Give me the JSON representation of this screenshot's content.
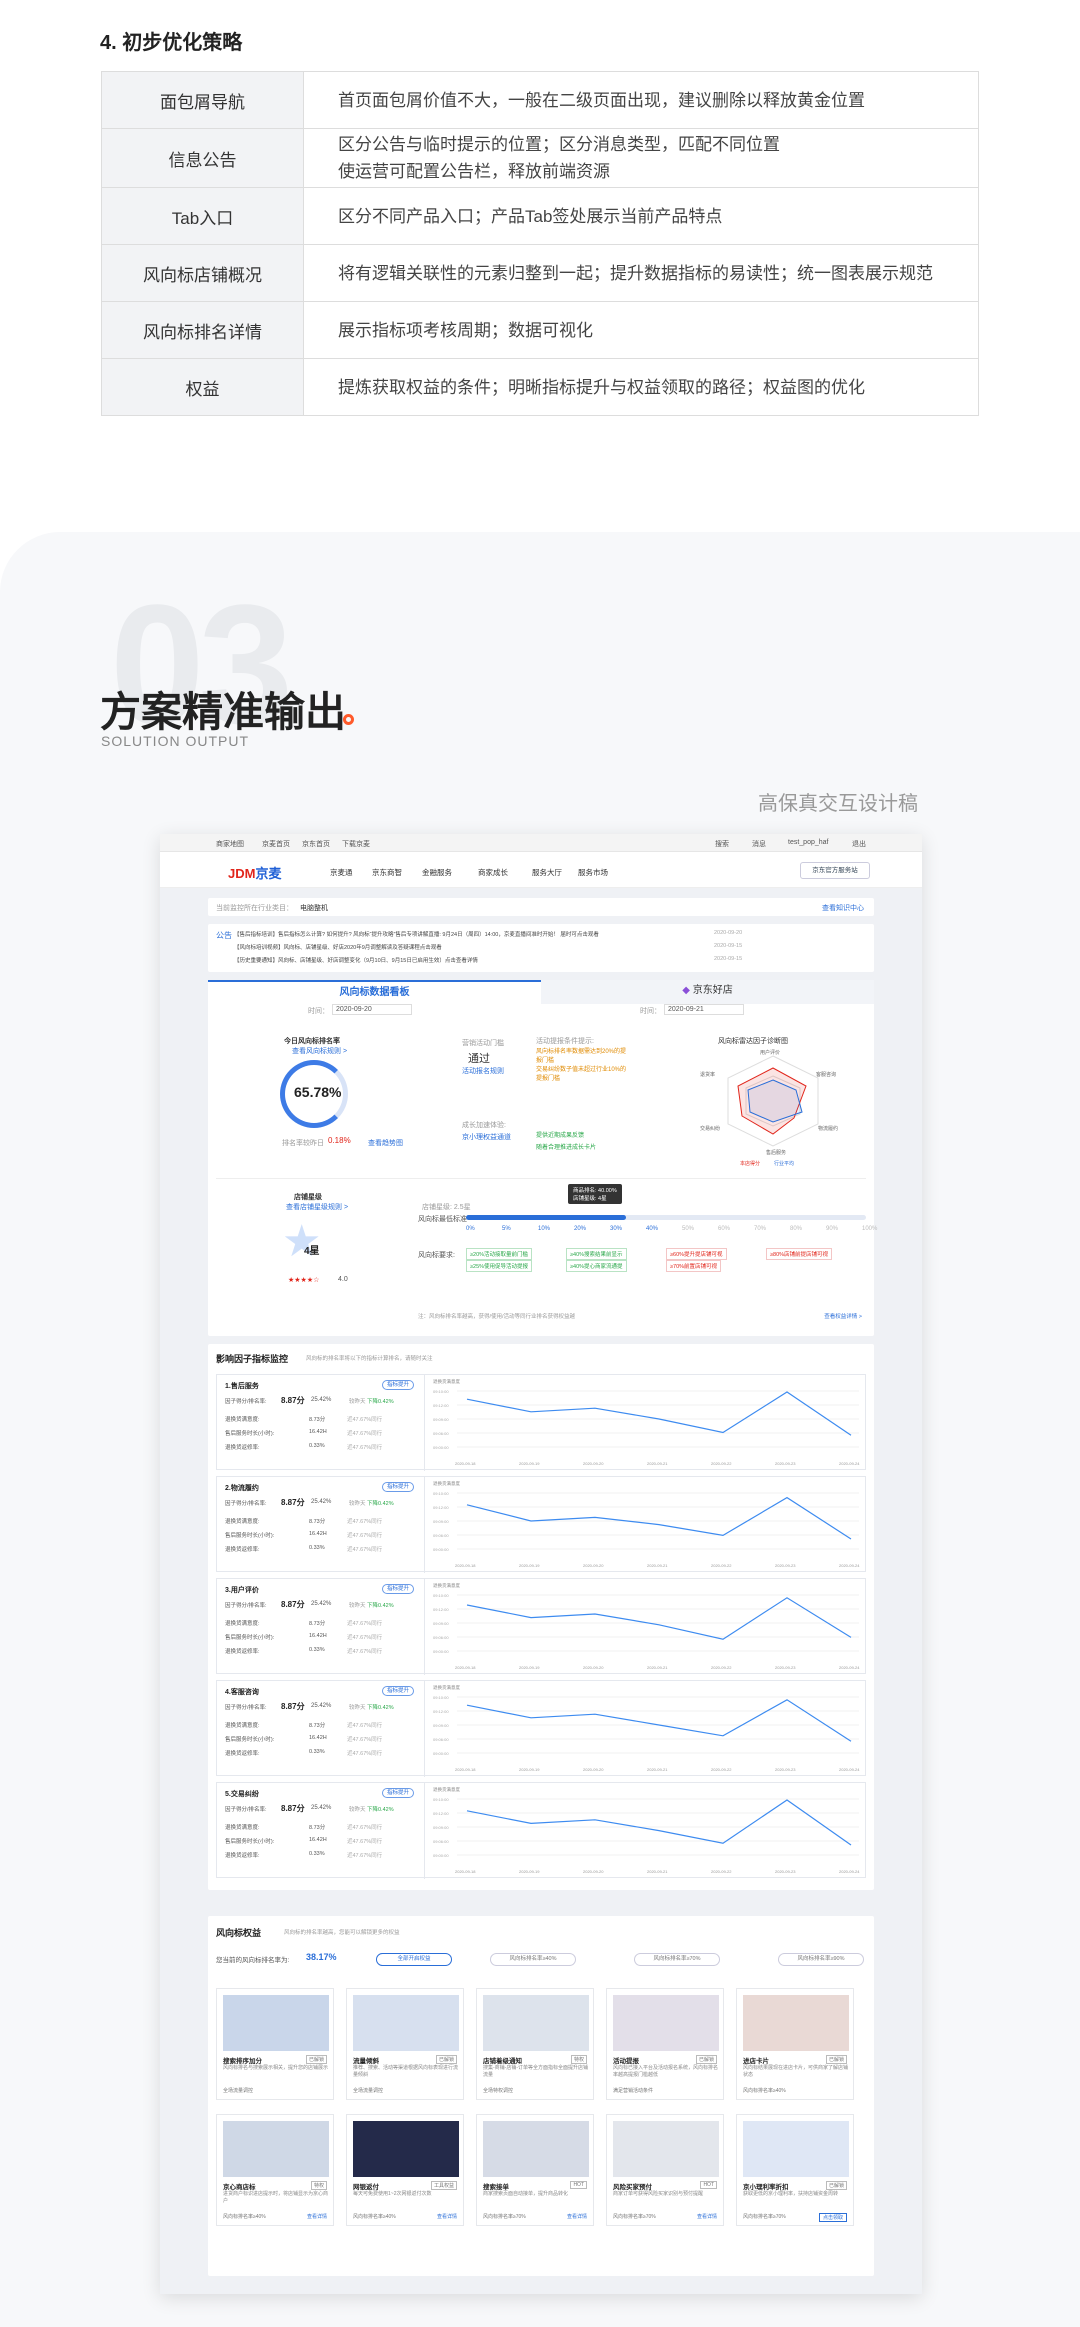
{
  "section4": {
    "title": "4. 初步优化策略",
    "rows": [
      {
        "k": "面包屑导航",
        "v": "首页面包屑价值不大，一般在二级页面出现，建议删除以释放黄金位置"
      },
      {
        "k": "信息公告",
        "v": "区分公告与临时提示的位置；区分消息类型，匹配不同位置\n使运营可配置公告栏，释放前端资源"
      },
      {
        "k": "Tab入口",
        "v": "区分不同产品入口；产品Tab签处展示当前产品特点"
      },
      {
        "k": "风向标店铺概况",
        "v": "将有逻辑关联性的元素归整到一起；提升数据指标的易读性；统一图表展示规范"
      },
      {
        "k": "风向标排名详情",
        "v": "展示指标项考核周期；数据可视化"
      },
      {
        "k": "权益",
        "v": "提炼获取权益的条件；明晰指标提升与权益领取的路径；权益图的优化"
      }
    ]
  },
  "section3": {
    "number": "03",
    "title": "方案精准输出",
    "subtitle": "SOLUTION OUTPUT",
    "caption": "高保真交互设计稿"
  },
  "mock": {
    "topbar": [
      "商家地图",
      "京麦首页",
      "京东首页",
      "下载京麦"
    ],
    "topbar_right": [
      "搜索",
      "消息",
      "test_pop_haf",
      "退出"
    ],
    "logo_main": "JDM",
    "logo_sub": "京麦",
    "nav": [
      "京麦通",
      "京东商智",
      "金融服务",
      "商家成长",
      "服务大厅",
      "服务市场"
    ],
    "nav_btn": "京东官方服务站",
    "crumb_label": "当前监控所在行业类目：",
    "crumb_value": "电脑整机",
    "crumb_link": "查看知识中心",
    "notice_label": "公告",
    "notices": [
      "【售后指标培训】售后指标怎么计算? 如何提升? 风向标“提升攻略”售后专项讲解直播: 9月24日（周四）14:00，京麦直播间准时开始！ 届时可点击观看",
      "【风向标培训视频】风向标、店铺星级、好店2020年9月调整解读及答疑课程点击观看",
      "【历史重要通知】风向标、店铺星级、好店调整变化（9月10日、9月15日已启用生效）点击查看详情"
    ],
    "notice_dates": [
      "2020-09-20",
      "2020-09-15",
      "2020-09-15"
    ],
    "tab_active": "风向标数据看板",
    "tab_other": "京东好店",
    "date_label": "时间：",
    "date_a": "2020-09-20",
    "date_b": "2020-09-21",
    "score_title": "今日风向标排名率",
    "score_link": "查看风向标规则 >",
    "score_value": "65.78%",
    "score_trend_label": "排名率较昨日",
    "score_trend": "0.18%",
    "score_trend_link": "查看趋势图",
    "threshold_title": "营销活动门槛",
    "threshold_value": "通过",
    "threshold_link": "活动报名规则",
    "threshold_tips_title": "活动提报条件提示:",
    "threshold_tips": [
      "风向标排名率数据需达到20%的提报门槛",
      "交易纠纷数子值未超过行业10%的提报门槛"
    ],
    "growth_title": "成长加速体验:",
    "growth_value": "京小理权益通道",
    "growth_tips": [
      "提供近期成果反馈",
      "随着合理推进成长卡片"
    ],
    "radar_title": "风向标雷达因子诊断图",
    "radar_labels": [
      "用户评价",
      "客服咨询",
      "物流履约",
      "售后服务",
      "交易纠纷",
      "退货率"
    ],
    "radar_legend": [
      "本店得分",
      "行业平均"
    ],
    "star_title": "店铺星级",
    "star_link": "查看店铺星级规则 >",
    "star_value": "4星",
    "star_score": "4.0",
    "tooltip": [
      "商品排名: 40.00%",
      "店铺星级: 4星"
    ],
    "progress_label_top": "店铺星级: 2.5星",
    "progress_label_row": "风向标最低标准",
    "progress_ticks": [
      "0%",
      "5%",
      "10%",
      "20%",
      "30%",
      "40%",
      "50%",
      "60%",
      "70%",
      "80%",
      "90%",
      "100%"
    ],
    "req_label": "风向标要求:",
    "reqs": [
      "≥20%活动接取量前门槛",
      "≥40%搜索结果前显示",
      "≥60%提升提店铺可视",
      "≥80%店铺前提店铺可视",
      "≥25%使用促导活动提报",
      "≥40%提心商家流通提",
      "≥70%前置店铺可视"
    ],
    "req_footer": "注：风向标排名率越高，获得/使用/活动等同行业排名获得权益越",
    "req_footer_link": "查看权益详情 >",
    "factor_title": "影响因子指标监控",
    "factor_sub": "风向标的排名率将以下的指标计算排名，请随时关注",
    "factor_rows": [
      {
        "name": "1.售后服务"
      },
      {
        "name": "2.物流履约"
      },
      {
        "name": "3.用户评价"
      },
      {
        "name": "4.客服咨询"
      },
      {
        "name": "5.交易纠纷"
      }
    ],
    "factor_badge": "指标提升",
    "factor_score_label": "因子得分/排名率:",
    "factor_score": "8.87分",
    "factor_rank": "25.42%",
    "factor_change_label": "较昨天",
    "factor_change": "下降0.42%",
    "factor_metrics": [
      {
        "label": "退换货满意度:",
        "value": "8.73分",
        "cmp": "近47.67%同行"
      },
      {
        "label": "售后服务时长(小时):",
        "value": "16.42H",
        "cmp": "近47.67%同行"
      },
      {
        "label": "退换货返修率:",
        "value": "0.33%",
        "cmp": "近47.67%同行"
      }
    ],
    "chart_dates": [
      "2020-09-18",
      "2020-09-19",
      "2020-09-20",
      "2020-09-21",
      "2020-09-22",
      "2020-09-23",
      "2020-09-24"
    ],
    "chart_ylabels": [
      "09:10:00",
      "09:12:00",
      "09:09:00",
      "09:06:00",
      "09:00:00"
    ],
    "chart_legend": "退换货满意度",
    "rights_title": "风向标权益",
    "rights_sub": "风向标的排名率越高，您能可以解锁更多的权益",
    "rights_rate_label": "您当前的风向标排名率为:",
    "rights_rate": "38.17%",
    "rights_pills": [
      "全部开启权益",
      "风向标排名率≥40%",
      "风向标排名率≥70%",
      "风向标排名率≥90%"
    ],
    "rights": [
      {
        "t": "搜索排序加分",
        "tag": "已解锁",
        "d": "风向标排名与搜索展示相关，提升您的店铺展示",
        "f": "全场流量调控"
      },
      {
        "t": "流量倾斜",
        "tag": "已解锁",
        "d": "推荐、搜索、活动等渠道根据风向标表现进行流量倾斜",
        "f": "全场流量调控"
      },
      {
        "t": "店铺着级通知",
        "tag": "特权",
        "d": "搜集‑商铺‑店铺‑订单等全方面指标全面提升店铺流量",
        "f": "全场特权调控"
      },
      {
        "t": "活动提报",
        "tag": "已解锁",
        "d": "风向标已接入平台及活动报名系统，风向标排名率越高提报门槛越低",
        "f": "满足营销活动条件"
      },
      {
        "t": "进店卡片",
        "tag": "已解锁",
        "d": "风向标结果展现在进店卡片，可供商家了解店铺状态",
        "f": "风向标排名率≥40%"
      },
      {
        "t": "京心商店标",
        "tag": "特权",
        "d": "进货商户标识进店提示时，将店铺显示为京心商户",
        "f": "风向标排名率≥40%"
      },
      {
        "t": "网银返付",
        "tag": "工具权益",
        "d": "每天可免费使用1~2次网银返付次数",
        "f": "风向标排名率≥40%"
      },
      {
        "t": "搜索接单",
        "tag": "HOT",
        "d": "商家搜索页面自动接单，提升商品转化",
        "f": "风向标排名率≥70%"
      },
      {
        "t": "风险买家预付",
        "tag": "HOT",
        "d": "商家订单可获得风险买家识别与预付提醒",
        "f": "风向标排名率≥70%"
      },
      {
        "t": "京小理利率折扣",
        "tag": "已解锁",
        "d": "获取更低的京小理利率，扶持店铺资金周转",
        "f": "风向标排名率≥70%"
      }
    ],
    "rights_link": "查看详情",
    "rights_btn": "点击领取"
  },
  "colors": {
    "accent": "#2a6ed8",
    "brand_red": "#e1251b",
    "dot": "#ff5a2a"
  }
}
